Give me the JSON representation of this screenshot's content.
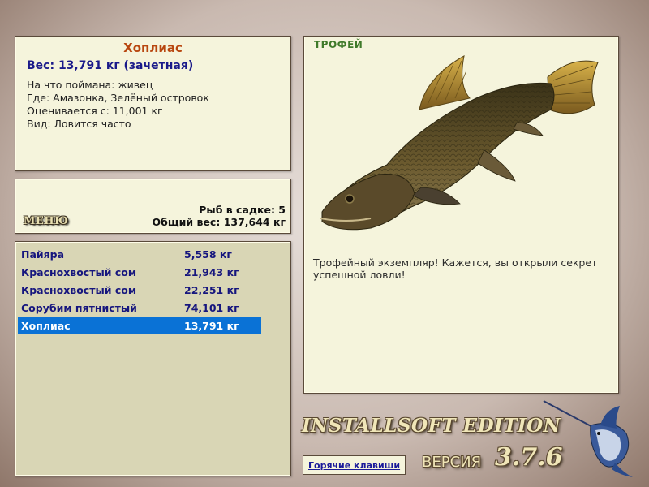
{
  "info": {
    "fish_name": "Хоплиас",
    "weight_line": "Вес: 13,791 кг (зачетная)",
    "caught_on": "На что поймана: живец",
    "location": "Где: Амазонка, Зелёный островок",
    "valued_from": "Оценивается с: 11,001 кг",
    "frequency": "Вид: Ловится часто"
  },
  "summary": {
    "menu_label": "МЕНЮ",
    "fish_count": "Рыб в садке: 5",
    "total_weight": "Общий вес: 137,644 кг"
  },
  "catch_list": [
    {
      "name": "Пайяра",
      "weight": "5,558 кг",
      "selected": false
    },
    {
      "name": "Краснохвостый сом",
      "weight": "21,943 кг",
      "selected": false
    },
    {
      "name": "Краснохвостый сом",
      "weight": "22,251 кг",
      "selected": false
    },
    {
      "name": "Сорубим пятнистый",
      "weight": "74,101 кг",
      "selected": false
    },
    {
      "name": "Хоплиас",
      "weight": "13,791 кг",
      "selected": true
    }
  ],
  "trophy": {
    "label": "ТРОФЕЙ",
    "message": "Трофейный экземпляр! Кажется, вы открыли секрет успешной ловли!"
  },
  "footer": {
    "brand": "INSTALLSOFT EDITION",
    "hotkeys": "Горячие клавиши",
    "version_label": "ВЕРСИЯ",
    "version_number": "3.7.6"
  },
  "colors": {
    "panel_bg": "#f5f4dc",
    "list_bg": "#d9d6b5",
    "selection": "#0a72d6",
    "fish_name": "#b8460f",
    "weight_text": "#1a1a8a"
  },
  "icons": {
    "fish_image": "hoplias-fish-image",
    "marlin_logo": "marlin-logo"
  }
}
